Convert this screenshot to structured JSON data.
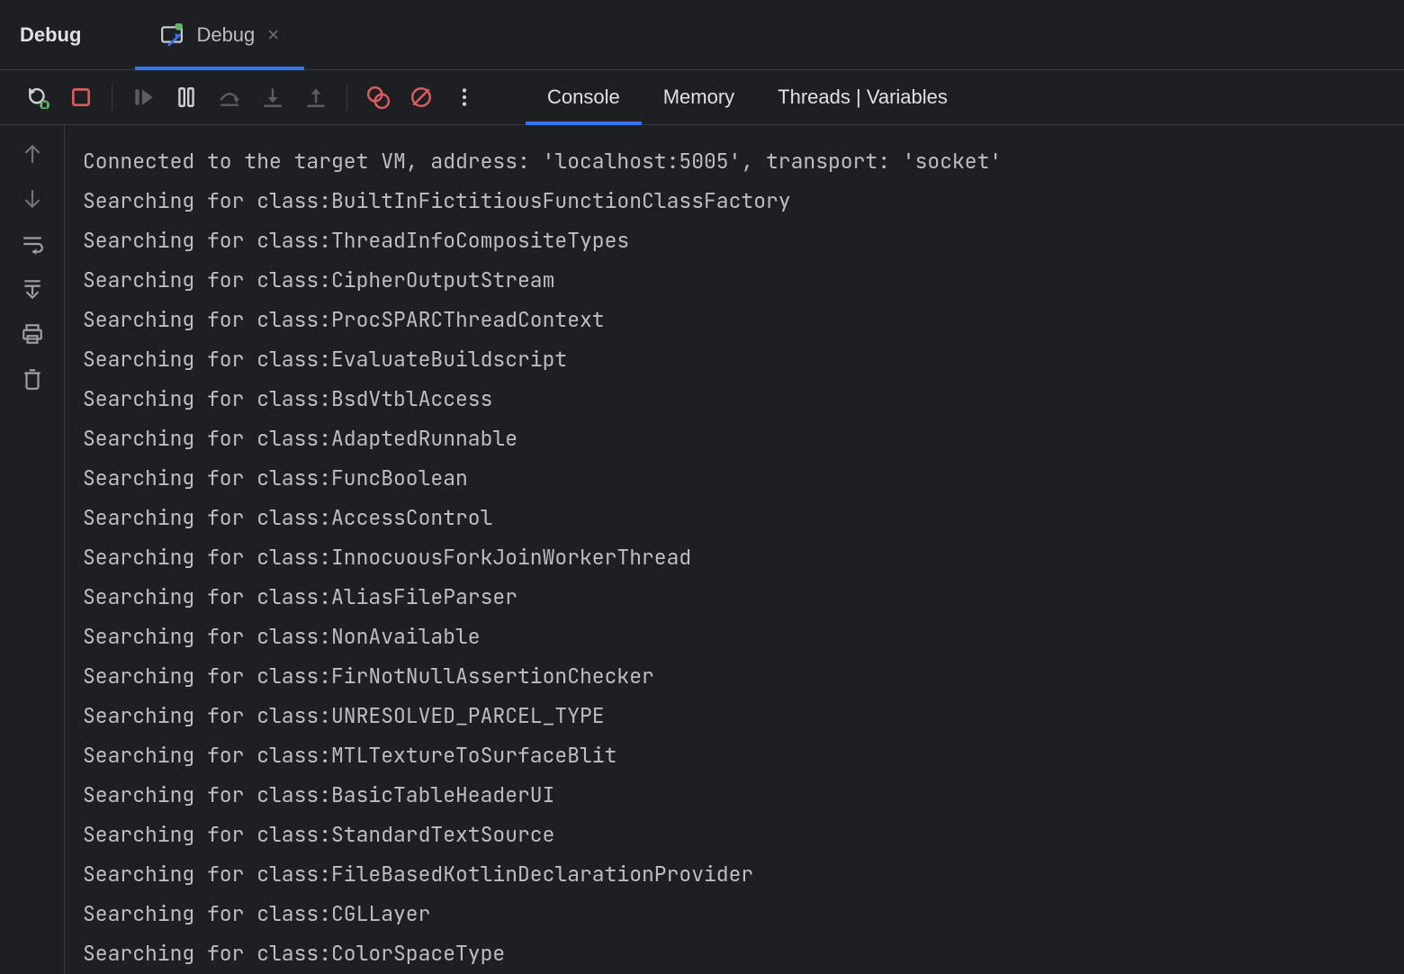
{
  "toolwindow": {
    "title": "Debug"
  },
  "tabs": [
    {
      "label": "Debug",
      "active": true
    }
  ],
  "toolbar": {
    "rerun": "Rerun",
    "stop": "Stop",
    "resume": "Resume Program",
    "pause": "Pause Program",
    "step_over": "Step Over",
    "step_into": "Step Into",
    "step_out": "Step Out",
    "view_breakpoints": "View Breakpoints",
    "mute_breakpoints": "Mute Breakpoints",
    "more": "More"
  },
  "sub_tabs": [
    {
      "label": "Console",
      "active": true
    },
    {
      "label": "Memory",
      "active": false
    },
    {
      "label": "Threads | Variables",
      "active": false
    }
  ],
  "gutter": {
    "up": "Previous",
    "down": "Next",
    "soft_wrap": "Soft-Wrap",
    "scroll_end": "Scroll to End",
    "print": "Print",
    "clear": "Clear All"
  },
  "console_lines": [
    "Connected to the target VM, address: 'localhost:5005', transport: 'socket'",
    "Searching for class:BuiltInFictitiousFunctionClassFactory",
    "Searching for class:ThreadInfoCompositeTypes",
    "Searching for class:CipherOutputStream",
    "Searching for class:ProcSPARCThreadContext",
    "Searching for class:EvaluateBuildscript",
    "Searching for class:BsdVtblAccess",
    "Searching for class:AdaptedRunnable",
    "Searching for class:FuncBoolean",
    "Searching for class:AccessControl",
    "Searching for class:InnocuousForkJoinWorkerThread",
    "Searching for class:AliasFileParser",
    "Searching for class:NonAvailable",
    "Searching for class:FirNotNullAssertionChecker",
    "Searching for class:UNRESOLVED_PARCEL_TYPE",
    "Searching for class:MTLTextureToSurfaceBlit",
    "Searching for class:BasicTableHeaderUI",
    "Searching for class:StandardTextSource",
    "Searching for class:FileBasedKotlinDeclarationProvider",
    "Searching for class:CGLLayer",
    "Searching for class:ColorSpaceType"
  ]
}
